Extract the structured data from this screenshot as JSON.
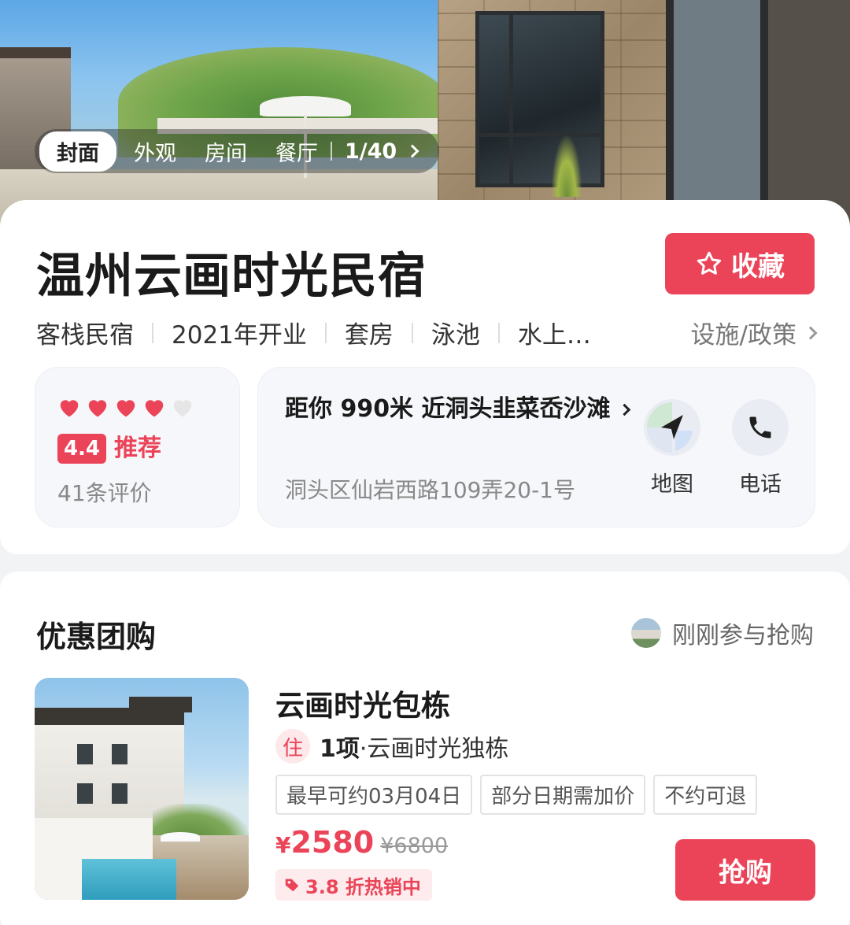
{
  "gallery": {
    "tabs": [
      "封面",
      "外观",
      "房间",
      "餐厅"
    ],
    "counter": "1/40"
  },
  "hotel": {
    "name": "温州云画时光民宿",
    "favorite_label": "收藏",
    "tags": [
      "客栈民宿",
      "2021年开业",
      "套房",
      "泳池",
      "水上…"
    ],
    "facilities_label": "设施/政策"
  },
  "rating": {
    "hearts_filled": 4,
    "hearts_total": 5,
    "score": "4.4",
    "label": "推荐",
    "reviews": "41条评价"
  },
  "location": {
    "distance": "距你 990米 近洞头韭菜岙沙滩",
    "address": "洞头区仙岩西路109弄20-1号",
    "map_label": "地图",
    "phone_label": "电话"
  },
  "deals": {
    "section_title": "优惠团购",
    "just_joined": "刚刚参与抢购",
    "item": {
      "name": "云画时光包栋",
      "stay_badge": "住",
      "stay_count": "1项",
      "stay_desc": "·云画时光独栋",
      "chips": [
        "最早可约03月04日",
        "部分日期需加价",
        "不约可退"
      ],
      "currency": "¥",
      "price": "2580",
      "original_price": "¥6800",
      "hot_label": "3.8 折热销中",
      "buy_label": "抢购"
    }
  },
  "colors": {
    "accent": "#eb4458",
    "heart_empty": "#e6e6e6"
  }
}
